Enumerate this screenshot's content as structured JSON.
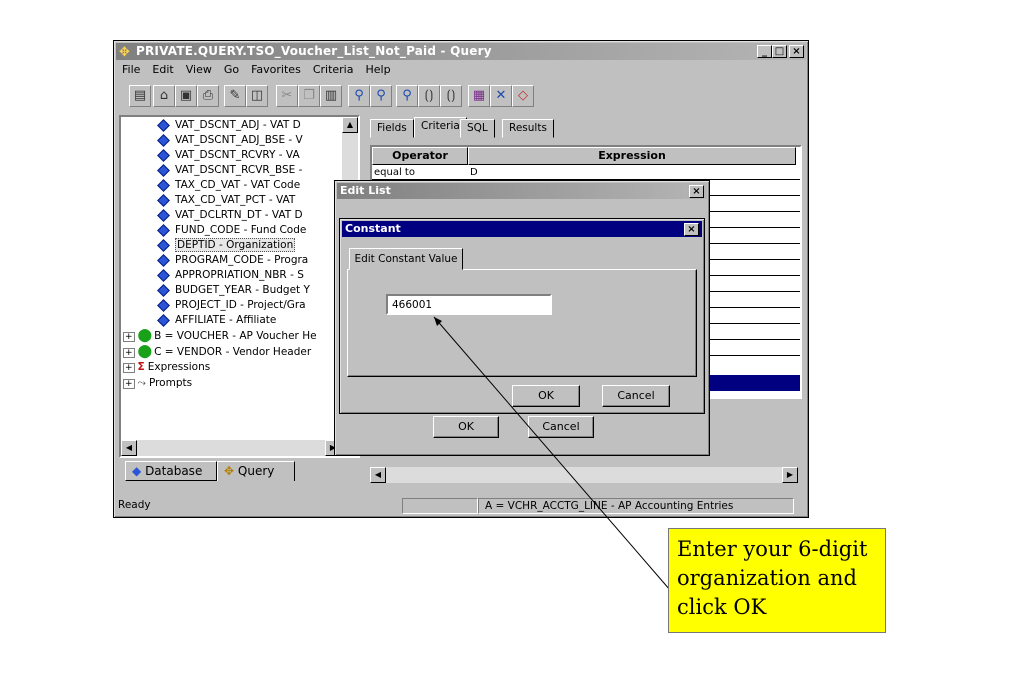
{
  "window": {
    "title": "PRIVATE.QUERY.TSO_Voucher_List_Not_Paid - Query",
    "icon": "query-icon",
    "controls": [
      "_",
      "□",
      "×"
    ]
  },
  "menu": [
    {
      "label": "File"
    },
    {
      "label": "Edit"
    },
    {
      "label": "View"
    },
    {
      "label": "Go"
    },
    {
      "label": "Favorites"
    },
    {
      "label": "Criteria"
    },
    {
      "label": "Help"
    }
  ],
  "toolbar_icons": [
    "new-icon",
    "open-icon",
    "save-icon",
    "print-icon",
    "find-icon",
    "properties-icon",
    "cut-icon",
    "copy-icon",
    "paste-icon",
    "add-criteria-icon",
    "delete-criteria-icon",
    "edit-criteria-icon",
    "group-icon",
    "ungroup-icon",
    "run-icon",
    "clear-icon",
    "erase-icon"
  ],
  "tree": {
    "fields": [
      "VAT_DSCNT_ADJ - VAT D",
      "VAT_DSCNT_ADJ_BSE - V",
      "VAT_DSCNT_RCVRY - VA",
      "VAT_DSCNT_RCVR_BSE -",
      "TAX_CD_VAT - VAT Code",
      "TAX_CD_VAT_PCT - VAT",
      "VAT_DCLRTN_DT - VAT D",
      "FUND_CODE - Fund Code",
      "DEPTID - Organization",
      "PROGRAM_CODE - Progra",
      "APPROPRIATION_NBR - S",
      "BUDGET_YEAR - Budget Y",
      "PROJECT_ID - Project/Gra",
      "AFFILIATE - Affiliate"
    ],
    "groups": [
      {
        "label": "B = VOUCHER - AP Voucher He",
        "icon": "record-icon"
      },
      {
        "label": "C = VENDOR - Vendor Header",
        "icon": "record-icon"
      },
      {
        "label": "Expressions",
        "icon": "sigma-icon"
      },
      {
        "label": "Prompts",
        "icon": "prompt-icon"
      }
    ],
    "selected_index": 8
  },
  "bottom_tabs": {
    "database": "Database",
    "query": "Query"
  },
  "tabs": [
    "Fields",
    "Criteria",
    "SQL",
    "Results"
  ],
  "grid": {
    "headers": {
      "operator": "Operator",
      "expression": "Expression"
    },
    "first_row": {
      "operator": "equal to",
      "expression": "D"
    }
  },
  "status": {
    "left": "Ready",
    "record": "A = VCHR_ACCTG_LINE - AP Accounting Entries"
  },
  "edit_list": {
    "title": "Edit List",
    "ok": "OK",
    "cancel": "Cancel"
  },
  "constant": {
    "title": "Constant",
    "tab": "Edit Constant Value",
    "value": "466001",
    "ok": "OK",
    "cancel": "Cancel"
  },
  "callout": {
    "text": "Enter your 6-digit organization and click OK"
  },
  "colors": {
    "active_title": "#000080",
    "callout": "#ffff00",
    "selection": "#000080"
  }
}
